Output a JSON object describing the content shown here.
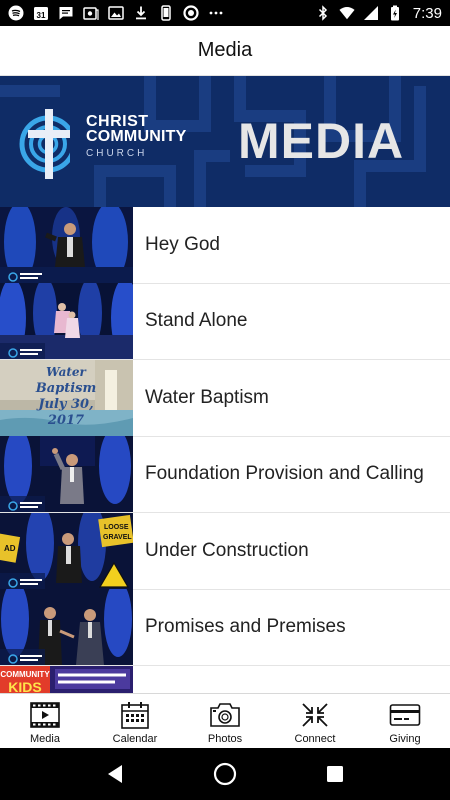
{
  "status_bar": {
    "time": "7:39",
    "calendar_day": "31",
    "icons_left": [
      "spotify-icon",
      "calendar-icon",
      "message-icon",
      "photo-gallery-icon",
      "image-icon",
      "download-icon",
      "phone-icon",
      "circle-app-icon",
      "more-icon"
    ],
    "icons_right": [
      "bluetooth-icon",
      "wifi-icon",
      "signal-icon",
      "battery-icon"
    ]
  },
  "header": {
    "title": "Media"
  },
  "banner": {
    "church_line1": "CHRIST",
    "church_line2": "COMMUNITY",
    "church_line3": "CHURCH",
    "heading": "MEDIA",
    "colors": {
      "background": "#0f2c66",
      "logo_accent": "#3aa6e8"
    }
  },
  "media_items": [
    {
      "title": "Hey God",
      "thumb": "speaker-stage"
    },
    {
      "title": "Stand Alone",
      "thumb": "stage-performers"
    },
    {
      "title": "Water Baptism",
      "thumb": "water-baptism-graphic",
      "thumb_text": [
        "Water",
        "Baptism",
        "July 30,",
        "2017"
      ]
    },
    {
      "title": "Foundation Provision and Calling",
      "thumb": "speaker-waving"
    },
    {
      "title": "Under Construction",
      "thumb": "speaker-construction-signs",
      "thumb_text": [
        "LOOSE",
        "GRAVEL",
        "AD"
      ]
    },
    {
      "title": "Promises and Premises",
      "thumb": "two-speakers"
    },
    {
      "title": "",
      "thumb": "community-kids",
      "thumb_text": [
        "COMMUNITY",
        "KIDS"
      ]
    }
  ],
  "tabs": [
    {
      "label": "Media",
      "icon": "film-play-icon"
    },
    {
      "label": "Calendar",
      "icon": "calendar-icon"
    },
    {
      "label": "Photos",
      "icon": "camera-icon"
    },
    {
      "label": "Connect",
      "icon": "connect-arrows-icon"
    },
    {
      "label": "Giving",
      "icon": "credit-card-icon"
    }
  ],
  "nav": [
    "back-icon",
    "home-icon",
    "recents-icon"
  ]
}
